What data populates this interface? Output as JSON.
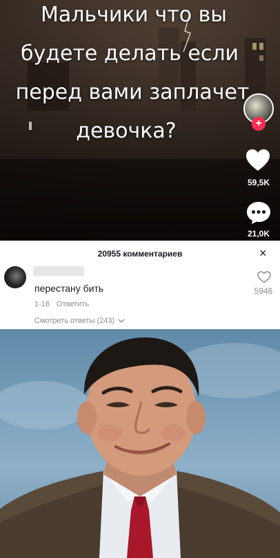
{
  "video": {
    "caption_lines": [
      "Мальчики что вы",
      "будете делать если",
      "перед вами заплачет",
      "девочка?"
    ],
    "like_count": "59,5K",
    "comment_count": "21,0K",
    "follow_symbol": "+"
  },
  "comments": {
    "title": "20955 комментариев",
    "close_symbol": "×",
    "items": [
      {
        "text": "перестану бить",
        "date": "1-16",
        "reply_label": "Ответить",
        "likes": "5946",
        "view_replies": "Смотреть ответы (243)"
      }
    ]
  },
  "colors": {
    "follow_badge": "#fe2c55",
    "panel_bg": "#ffffff",
    "secondary_text": "#8a8b91"
  },
  "icons": [
    "heart-icon",
    "comment-bubble-icon",
    "close-icon",
    "chevron-down-icon",
    "like-outline-icon"
  ]
}
